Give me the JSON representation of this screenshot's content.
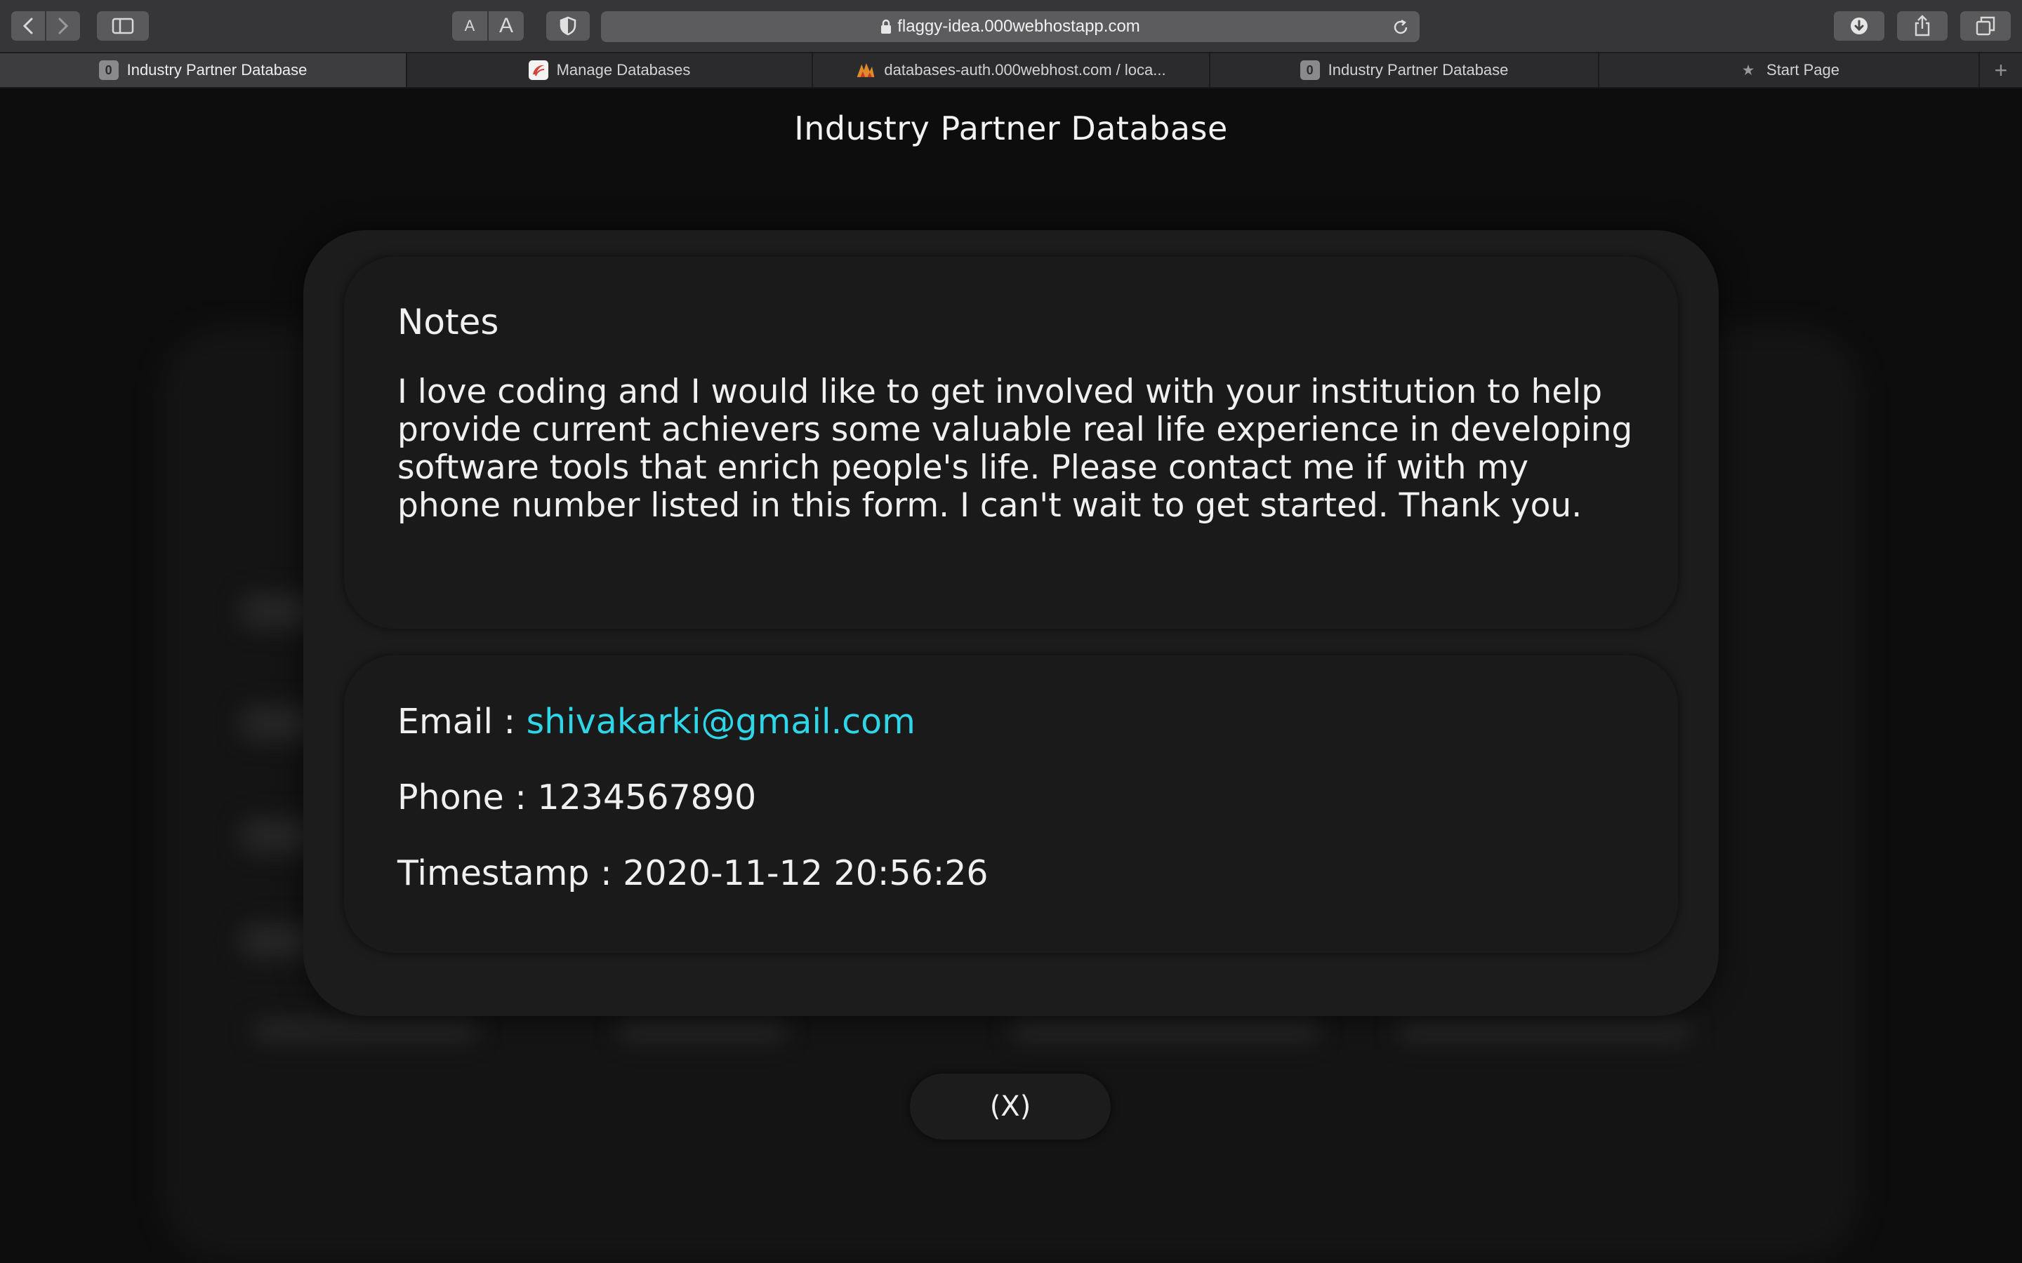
{
  "browser": {
    "url": "flaggy-idea.000webhostapp.com",
    "text_size_small": "A",
    "text_size_large": "A",
    "tabs": [
      {
        "title": "Industry Partner Database",
        "favicon": "0",
        "active": true
      },
      {
        "title": "Manage Databases",
        "favicon": "phpmyadmin-icon",
        "active": false
      },
      {
        "title": "databases-auth.000webhost.com / loca...",
        "favicon": "database-server-icon",
        "active": false
      },
      {
        "title": "Industry Partner Database",
        "favicon": "0",
        "active": false
      },
      {
        "title": "Start Page",
        "favicon": "star-icon",
        "active": false
      }
    ],
    "new_tab": "+"
  },
  "page": {
    "title": "Industry Partner Database",
    "notes": {
      "heading": "Notes",
      "body": "I love coding and I would like to get involved with your institution to help provide current achievers some valuable real life experience in developing software tools that enrich people's life. Please contact me if with my phone number listed in this form. I can't wait to get started. Thank you."
    },
    "contact": {
      "email_label": "Email : ",
      "email": "shivakarki@gmail.com",
      "phone_label": "Phone : ",
      "phone": "1234567890",
      "timestamp_label": "Timestamp : ",
      "timestamp": "2020-11-12 20:56:26"
    },
    "close_label": "(X)"
  },
  "colors": {
    "link": "#2fd6e8",
    "card_background": "#1a1a1a",
    "page_background": "#0d0d0d",
    "text": "#f0f0f0"
  }
}
